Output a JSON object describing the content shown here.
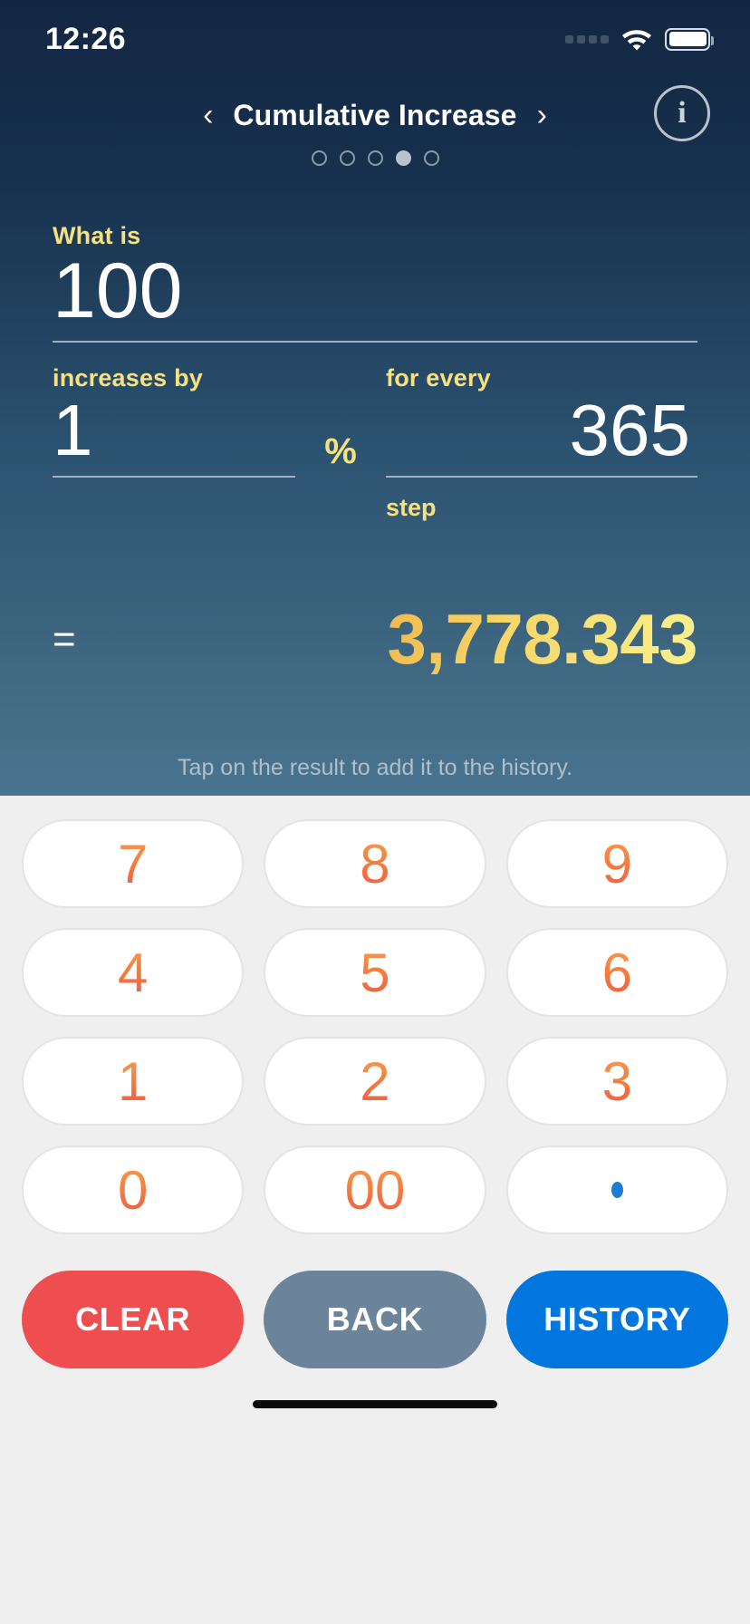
{
  "status_bar": {
    "time": "12:26",
    "signal_icon": "signal-bars-icon",
    "wifi_icon": "wifi-icon",
    "battery_icon": "battery-icon"
  },
  "header": {
    "prev_arrow": "‹",
    "title": "Cumulative Increase",
    "next_arrow": "›",
    "info_label": "i",
    "page_dots": {
      "total": 5,
      "active_index": 3
    }
  },
  "form": {
    "base": {
      "label": "What is",
      "value": "100"
    },
    "rate": {
      "label": "increases by",
      "value": "1",
      "unit": "%"
    },
    "steps": {
      "label": "for every",
      "value": "365",
      "sub_label": "step"
    },
    "result": {
      "equals": "=",
      "value": "3,778.343"
    },
    "hint": "Tap on the result to add it to the history."
  },
  "keypad": {
    "rows": [
      [
        "7",
        "8",
        "9"
      ],
      [
        "4",
        "5",
        "6"
      ],
      [
        "1",
        "2",
        "3"
      ],
      [
        "0",
        "00",
        "."
      ]
    ],
    "actions": [
      {
        "label": "CLEAR",
        "name": "clear-button",
        "color": "#ef4e51"
      },
      {
        "label": "BACK",
        "name": "back-button",
        "color": "#6b8499"
      },
      {
        "label": "HISTORY",
        "name": "history-button",
        "color": "#0076de"
      }
    ]
  },
  "colors": {
    "label_yellow": "#f5e17f",
    "result_gradient_start": "#f2b950",
    "result_gradient_end": "#fbf08d",
    "digit_gradient_start": "#f8a054",
    "digit_gradient_end": "#ef5746",
    "panel_top": "#132742",
    "panel_bottom": "#4a7490",
    "keypad_bg": "#efefef"
  }
}
